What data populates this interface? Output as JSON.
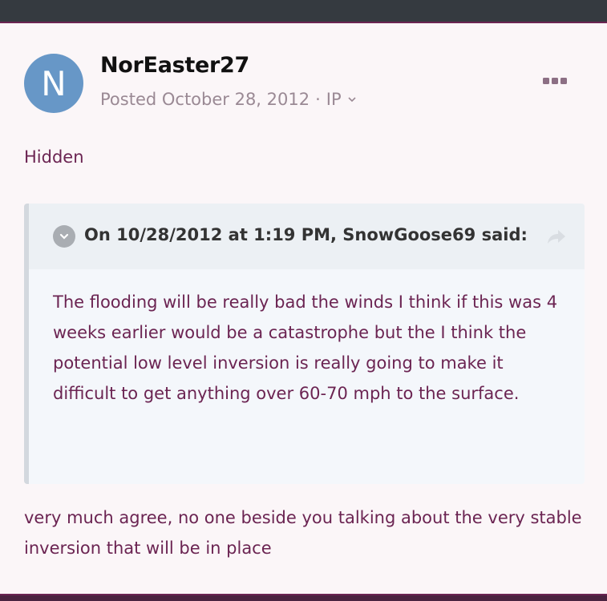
{
  "post": {
    "avatar_letter": "N",
    "author": "NorEaster27",
    "posted": "Posted October 28, 2012",
    "separator": "·",
    "ip_label": "IP",
    "hidden_label": "Hidden",
    "quote": {
      "citation": "On 10/28/2012 at 1:19 PM, SnowGoose69 said:",
      "body": "The flooding will be really bad the winds I think if this was 4 weeks earlier would be a catastrophe but the I think the potential low level inversion is really going to make it difficult to get anything over 60-70 mph to the surface."
    },
    "reply": "very much agree, no one beside you talking about the very stable inversion that will be in place"
  },
  "icons": {
    "more": "ellipsis-icon",
    "chevron": "chevron-down-icon",
    "share": "share-arrow-icon"
  },
  "colors": {
    "accent": "#6b2452",
    "avatar_bg": "#6797c7",
    "topbar": "#353a40"
  }
}
